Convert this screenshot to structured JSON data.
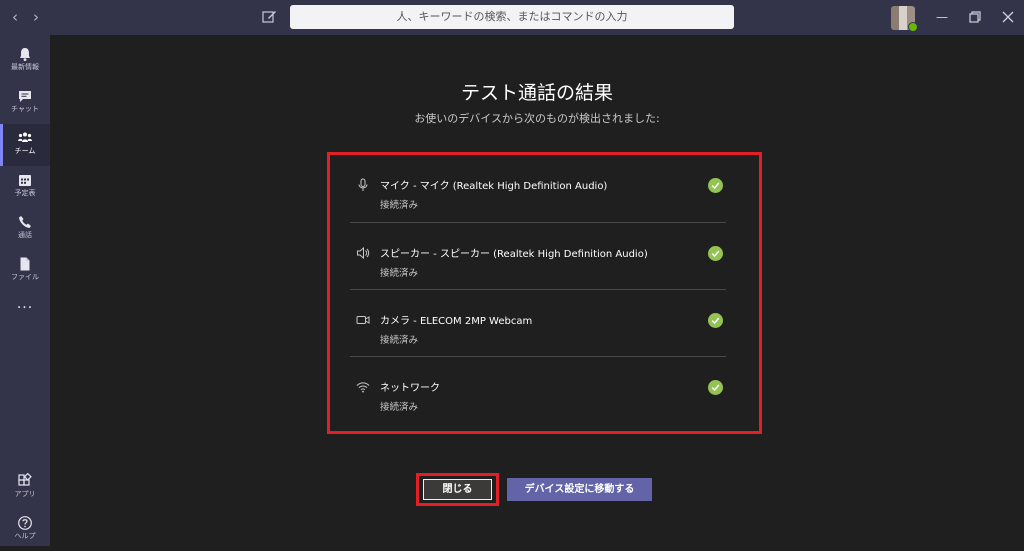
{
  "search": {
    "placeholder": "人、キーワードの検索、またはコマンドの入力"
  },
  "rail": {
    "items": [
      {
        "label": "最新情報",
        "icon": "bell-icon"
      },
      {
        "label": "チャット",
        "icon": "chat-icon"
      },
      {
        "label": "チーム",
        "icon": "teams-icon"
      },
      {
        "label": "予定表",
        "icon": "calendar-icon"
      },
      {
        "label": "通話",
        "icon": "phone-icon"
      },
      {
        "label": "ファイル",
        "icon": "file-icon"
      }
    ],
    "more": "...",
    "bottom": [
      {
        "label": "アプリ",
        "icon": "apps-icon"
      },
      {
        "label": "ヘルプ",
        "icon": "help-icon"
      }
    ]
  },
  "dialog": {
    "title": "テスト通話の結果",
    "subtitle": "お使いのデバイスから次のものが検出されました:",
    "devices": [
      {
        "icon": "microphone-icon",
        "name": "マイク - マイク (Realtek High Definition Audio)",
        "status": "接続済み"
      },
      {
        "icon": "speaker-icon",
        "name": "スピーカー - スピーカー (Realtek High Definition Audio)",
        "status": "接続済み"
      },
      {
        "icon": "camera-icon",
        "name": "カメラ - ELECOM 2MP Webcam",
        "status": "接続済み"
      },
      {
        "icon": "wifi-icon",
        "name": "ネットワーク",
        "status": "接続済み"
      }
    ],
    "close_label": "閉じる",
    "settings_label": "デバイス設定に移動する"
  },
  "colors": {
    "accent": "#6264a7",
    "highlight": "#e21f26",
    "success": "#92c353",
    "rail": "#33344a",
    "background": "#201f1f"
  }
}
